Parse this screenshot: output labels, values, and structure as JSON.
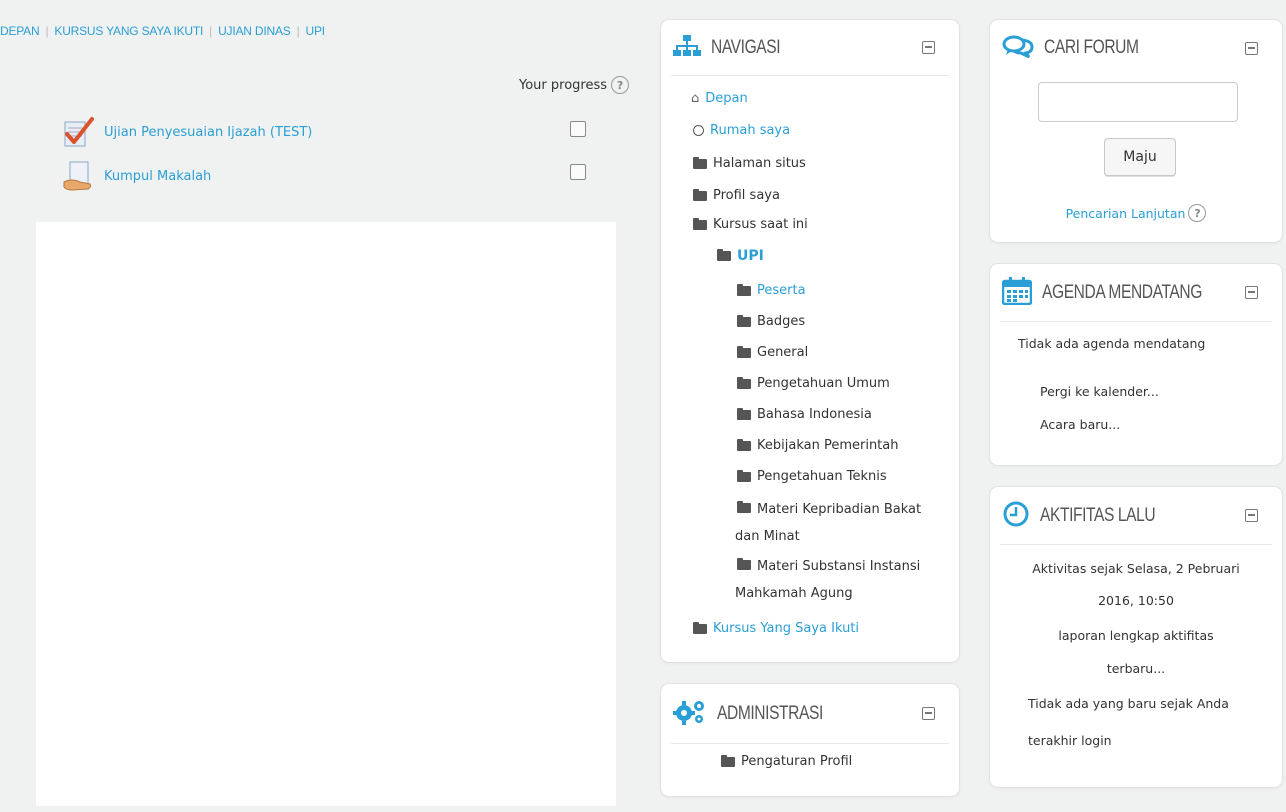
{
  "breadcrumb": {
    "items": [
      "DEPAN",
      "KURSUS YANG SAYA IKUTI",
      "UJIAN DINAS",
      "UPI"
    ],
    "separator": "|"
  },
  "main": {
    "progress_label": "Your progress",
    "help_glyph": "?",
    "activities": [
      {
        "label": "Ujian Penyesuaian Ijazah (TEST)",
        "icon": "quiz-check-icon"
      },
      {
        "label": "Kumpul Makalah",
        "icon": "assignment-hand-icon"
      }
    ]
  },
  "navigation": {
    "title": "NAVIGASI",
    "items": [
      {
        "label": "Depan",
        "icon": "home-icon"
      },
      {
        "label": "Rumah saya",
        "icon": "circle-icon"
      },
      {
        "label": "Halaman situs",
        "icon": "folder-icon"
      },
      {
        "label": "Profil saya",
        "icon": "folder-icon"
      },
      {
        "label": "Kursus saat ini",
        "icon": "folder-icon"
      },
      {
        "label": "UPI",
        "icon": "folder-icon"
      },
      {
        "label": "Peserta",
        "icon": "folder-icon"
      },
      {
        "label": "Badges",
        "icon": "folder-icon"
      },
      {
        "label": "General",
        "icon": "folder-icon"
      },
      {
        "label": "Pengetahuan Umum",
        "icon": "folder-icon"
      },
      {
        "label": "Bahasa Indonesia",
        "icon": "folder-icon"
      },
      {
        "label": "Kebijakan Pemerintah",
        "icon": "folder-icon"
      },
      {
        "label": "Pengetahuan Teknis",
        "icon": "folder-icon"
      },
      {
        "label": "Materi Kepribadian Bakat dan Minat",
        "icon": "folder-icon"
      },
      {
        "label": "Materi Substansi Instansi Mahkamah Agung",
        "icon": "folder-icon"
      },
      {
        "label": "Kursus Yang Saya Ikuti",
        "icon": "folder-icon"
      }
    ]
  },
  "administration": {
    "title": "ADMINISTRASI",
    "items": [
      {
        "label": "Pengaturan Profil",
        "icon": "folder-icon"
      }
    ]
  },
  "search_forum": {
    "title": "CARI FORUM",
    "input_value": "",
    "button_label": "Maju",
    "advanced_link": "Pencarian Lanjutan"
  },
  "upcoming_events": {
    "title": "AGENDA MENDATANG",
    "empty_text": "Tidak ada agenda mendatang",
    "link_calendar": "Pergi ke kalender...",
    "link_new_event": "Acara baru..."
  },
  "recent_activity": {
    "title": "AKTIFITAS LALU",
    "since_text_line1": "Aktivitas sejak Selasa, 2 Pebruari",
    "since_text_line2": "2016, 10:50",
    "full_report_line1": "laporan lengkap aktifitas",
    "full_report_line2": "terbaru...",
    "nothing_line1": "Tidak ada yang baru sejak Anda",
    "nothing_line2": "terakhir login"
  },
  "colors": {
    "link": "#2a9fd6",
    "background": "#f0f1f1",
    "block_bg": "#ffffff"
  }
}
